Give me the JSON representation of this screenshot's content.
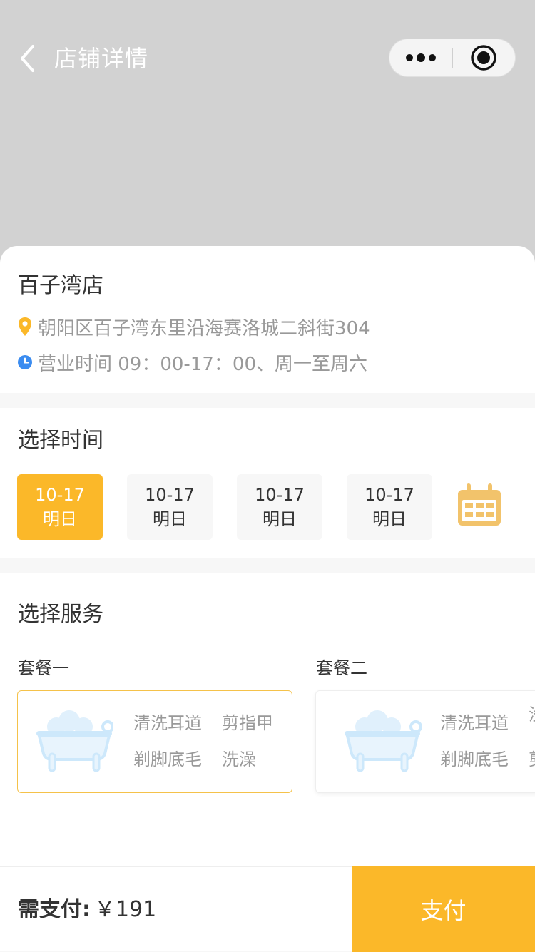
{
  "nav": {
    "title": "店铺详情"
  },
  "store": {
    "name": "百子湾店",
    "address": "朝阳区百子湾东里沿海赛洛城二斜街304",
    "hours": "营业时间 09：00-17：00、周一至周六"
  },
  "time": {
    "title": "选择时间",
    "dates": [
      {
        "date": "10-17",
        "label": "明日",
        "selected": true
      },
      {
        "date": "10-17",
        "label": "明日",
        "selected": false
      },
      {
        "date": "10-17",
        "label": "明日",
        "selected": false
      },
      {
        "date": "10-17",
        "label": "明日",
        "selected": false
      }
    ]
  },
  "service": {
    "title": "选择服务",
    "packages": [
      {
        "name": "套餐一",
        "tags": [
          "清洗耳道",
          "剪指甲",
          "剃脚底毛",
          "洗澡"
        ],
        "selected": true
      },
      {
        "name": "套餐二",
        "tags": [
          "清洗耳道",
          "洗",
          "剃脚底毛",
          "剪"
        ],
        "selected": false
      }
    ]
  },
  "footer": {
    "pay_label": "需支付:",
    "pay_amount": "￥191",
    "pay_button": "支付"
  },
  "colors": {
    "accent": "#fbb829",
    "banner": "#d2d2d2",
    "location_icon": "#fbb829",
    "clock_icon": "#3b8cf0",
    "bathtub_icon": "#cde8fb"
  },
  "icons": {
    "back": "chevron-left-icon",
    "more": "more-dots-icon",
    "close": "target-close-icon",
    "location": "location-pin-icon",
    "clock": "clock-icon",
    "calendar": "calendar-icon",
    "package": "bathtub-icon"
  }
}
